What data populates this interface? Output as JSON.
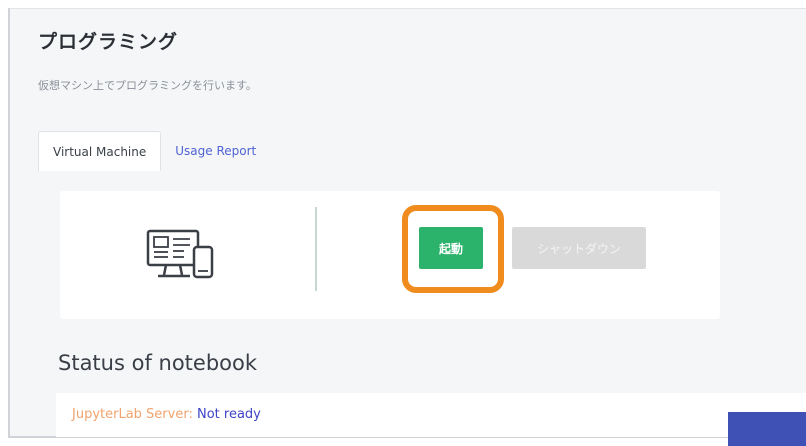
{
  "page": {
    "title": "プログラミング",
    "subtitle": "仮想マシン上でプログラミングを行います。"
  },
  "tabs": [
    {
      "label": "Virtual Machine",
      "active": true
    },
    {
      "label": "Usage Report",
      "active": false
    }
  ],
  "vm_panel": {
    "icon": "computer-devices-icon",
    "start_button": "起動",
    "shutdown_button": "シャットダウン",
    "shutdown_enabled": false,
    "highlight_color": "#f08b1d"
  },
  "status": {
    "heading": "Status of notebook",
    "label": "JupyterLab Server:",
    "value": "Not ready"
  },
  "colors": {
    "accent_green": "#2cb36b",
    "link_blue": "#4f63d2",
    "status_label": "#f0a36e",
    "status_value": "#3d44c4"
  }
}
